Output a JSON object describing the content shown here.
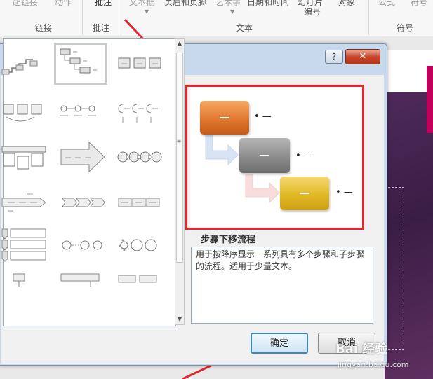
{
  "ribbon": {
    "top_items": [
      "超链接",
      "动作",
      "批注",
      "文本框",
      "页眉和页脚",
      "艺术字",
      "日期和时间",
      "幻灯片",
      "对象",
      "公式",
      "符号"
    ],
    "slide_number_line1": "幻灯片",
    "slide_number_line2": "编号",
    "groups": {
      "links": "链接",
      "comments": "批注",
      "text": "文本",
      "symbols": "符号"
    }
  },
  "dialog": {
    "help_label": "?",
    "close_label": "✕",
    "layout_name": "步骤下移流程",
    "layout_description": "用于按降序显示一系列具有多个步骤和子步骤的流程。适用于少量文本。",
    "preview_box_text": "—",
    "preview_bullet_text": "• —",
    "ok_label": "确定",
    "cancel_label": "取消"
  },
  "colors": {
    "highlight_red": "#e3262b",
    "step1_orange": "#e0782f",
    "step2_gray": "#8c8c8c",
    "step3_gold": "#e0b825",
    "ok_border": "#3b86c4"
  },
  "watermark": {
    "logo": "Bai  经验",
    "url": "jingyan.baidu.com"
  }
}
